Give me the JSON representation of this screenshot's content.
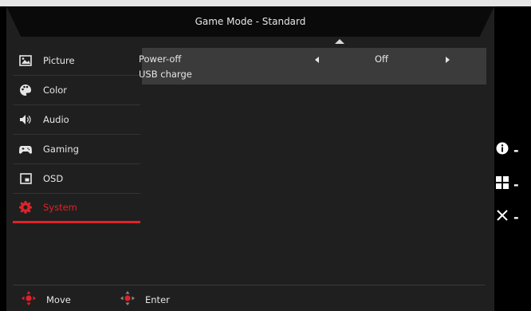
{
  "header": {
    "title": "Game Mode - Standard"
  },
  "sidebar": {
    "items": [
      {
        "label": "Picture",
        "icon": "picture-icon"
      },
      {
        "label": "Color",
        "icon": "palette-icon"
      },
      {
        "label": "Audio",
        "icon": "speaker-icon"
      },
      {
        "label": "Gaming",
        "icon": "gamepad-icon"
      },
      {
        "label": "OSD",
        "icon": "osd-icon"
      },
      {
        "label": "System",
        "icon": "gear-icon",
        "active": true
      }
    ]
  },
  "settings": {
    "power_off_label": "Power-off",
    "power_off_value": "Off",
    "usb_charge_label": "USB charge"
  },
  "footer": {
    "move_label": "Move",
    "enter_label": "Enter"
  },
  "side_keys": {
    "info": "info-icon",
    "menu": "grid-icon",
    "close": "close-icon",
    "dash": "-"
  },
  "colors": {
    "accent": "#e22227",
    "panel": "#1f1f1f",
    "selected_row": "#3b3b3b"
  }
}
